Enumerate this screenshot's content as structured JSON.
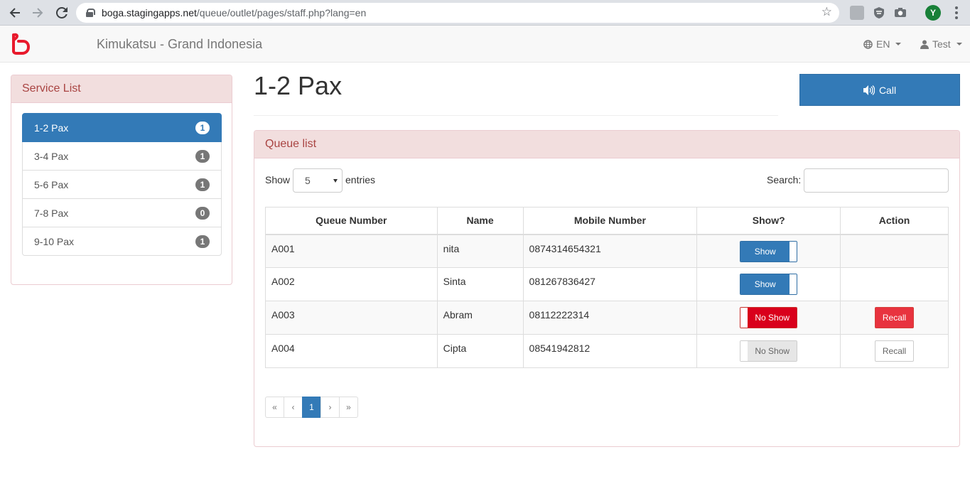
{
  "browser": {
    "url_host": "boga.stagingapps.net",
    "url_path": "/queue/outlet/pages/staff.php?lang=en",
    "profile_initial": "Y"
  },
  "navbar": {
    "brand": "Kimukatsu - Grand Indonesia",
    "language": "EN",
    "user": "Test",
    "logo_color": "#e8192c"
  },
  "sidebar": {
    "title": "Service List",
    "items": [
      {
        "label": "1-2 Pax",
        "count": "1"
      },
      {
        "label": "3-4 Pax",
        "count": "1"
      },
      {
        "label": "5-6 Pax",
        "count": "1"
      },
      {
        "label": "7-8 Pax",
        "count": "0"
      },
      {
        "label": "9-10 Pax",
        "count": "1"
      }
    ]
  },
  "main": {
    "title": "1-2 Pax",
    "call_label": "Call",
    "panel_title": "Queue list",
    "show_label": "Show",
    "entries_value": "5",
    "entries_label": "entries",
    "search_label": "Search:",
    "search_value": "",
    "columns": [
      "Queue Number",
      "Name",
      "Mobile Number",
      "Show?",
      "Action"
    ],
    "rows": [
      {
        "queue": "A001",
        "name": "nita",
        "mobile": "0874314654321",
        "show": "Show",
        "action": ""
      },
      {
        "queue": "A002",
        "name": "Sinta",
        "mobile": "081267836427",
        "show": "Show",
        "action": ""
      },
      {
        "queue": "A003",
        "name": "Abram",
        "mobile": "08112222314",
        "show": "No Show",
        "action": "Recall"
      },
      {
        "queue": "A004",
        "name": "Cipta",
        "mobile": "08541942812",
        "show": "No Show",
        "action": "Recall"
      }
    ],
    "pagination": {
      "first": "«",
      "prev": "‹",
      "current": "1",
      "next": "›",
      "last": "»"
    }
  },
  "colors": {
    "primary": "#337ab7",
    "danger_header": "#f2dede",
    "no_show_red": "#d9001b",
    "recall_red": "#e8333f"
  }
}
